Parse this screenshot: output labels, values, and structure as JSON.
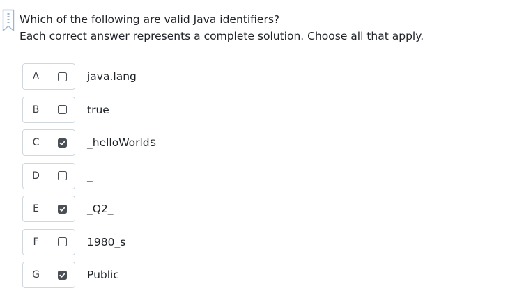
{
  "question": {
    "line1": "Which of the following are valid Java identifiers?",
    "line2": "Each correct answer represents a complete solution. Choose all that apply."
  },
  "options": [
    {
      "letter": "A",
      "text": "java.lang",
      "checked": false
    },
    {
      "letter": "B",
      "text": "true",
      "checked": false
    },
    {
      "letter": "C",
      "text": "_helloWorld$",
      "checked": true
    },
    {
      "letter": "D",
      "text": "_",
      "checked": false
    },
    {
      "letter": "E",
      "text": "_Q2_",
      "checked": true
    },
    {
      "letter": "F",
      "text": "1980_s",
      "checked": false
    },
    {
      "letter": "G",
      "text": "Public",
      "checked": true
    }
  ],
  "colors": {
    "border": "#d0d7de",
    "checkbox": "#4a4f55",
    "bookmark": "#9bb6d0"
  },
  "icons": {
    "bookmark": "bookmark-icon",
    "checkbox": "checkbox-icon"
  }
}
